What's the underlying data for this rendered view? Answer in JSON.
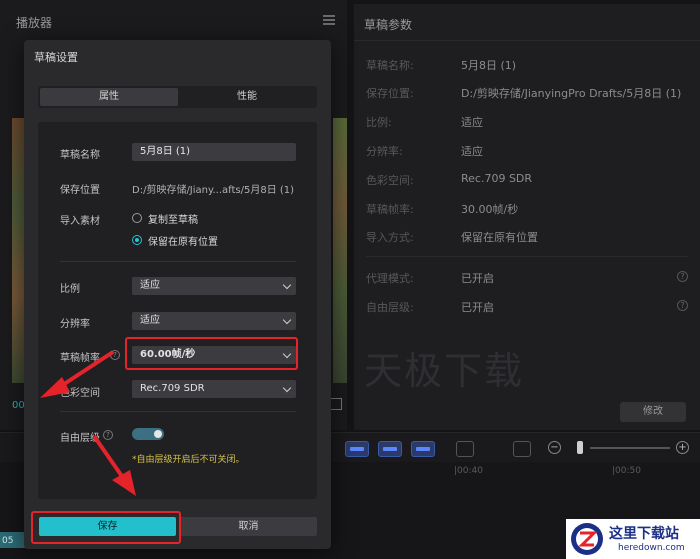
{
  "player": {
    "title": "播放器",
    "time": "00"
  },
  "params": {
    "title": "草稿参数",
    "rows": [
      {
        "key": "草稿名称:",
        "value": "5月8日 (1)"
      },
      {
        "key": "保存位置:",
        "value": "D:/剪映存储/JianyingPro Drafts/5月8日 (1)"
      },
      {
        "key": "比例:",
        "value": "适应"
      },
      {
        "key": "分辨率:",
        "value": "适应"
      },
      {
        "key": "色彩空间:",
        "value": "Rec.709 SDR"
      },
      {
        "key": "草稿帧率:",
        "value": "30.00帧/秒"
      },
      {
        "key": "导入方式:",
        "value": "保留在原有位置"
      },
      {
        "key": "代理模式:",
        "value": "已开启"
      },
      {
        "key": "自由层级:",
        "value": "已开启"
      }
    ],
    "watermark": "天极下载",
    "modify_label": "修改"
  },
  "dialog": {
    "title": "草稿设置",
    "tabs": {
      "attributes": "属性",
      "performance": "性能"
    },
    "labels": {
      "name": "草稿名称",
      "location": "保存位置",
      "import": "导入素材",
      "ratio": "比例",
      "resolution": "分辨率",
      "framerate": "草稿帧率",
      "colorspace": "色彩空间",
      "layer": "自由层级"
    },
    "name_value": "5月8日 (1)",
    "path_value": "D:/剪映存储/Jiany...afts/5月8日 (1)",
    "import_options": {
      "copy": "复制至草稿",
      "keep": "保留在原有位置"
    },
    "import_selected": "keep",
    "ratio_value": "适应",
    "resolution_value": "适应",
    "framerate_value": "60.00帧/秒",
    "colorspace_value": "Rec.709 SDR",
    "free_layer_enabled": true,
    "hint": "*自由层级开启后不可关闭。",
    "save_label": "保存",
    "cancel_label": "取消"
  },
  "timeline": {
    "ticks": [
      "|00:40",
      "|00:50"
    ],
    "clip_time": "05"
  },
  "logo": {
    "cn": "这里下载站",
    "en": "heredown.com"
  },
  "colors": {
    "accent": "#22c0cc",
    "highlight": "#e5232a",
    "hint": "#d7c34a"
  }
}
